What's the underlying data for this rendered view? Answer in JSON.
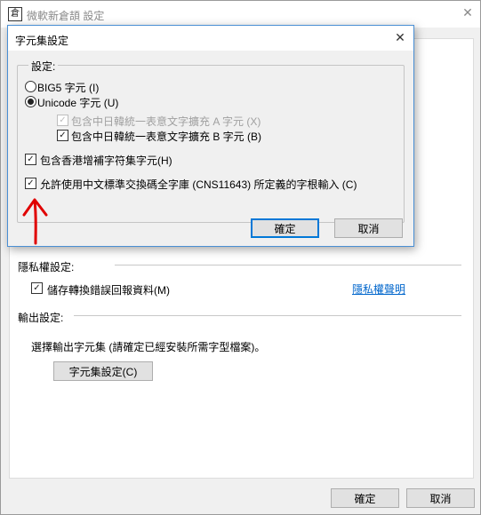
{
  "window": {
    "title": "微軟新倉頡 設定",
    "icon_name": "cangjie-app-icon",
    "icon_glyph": "倉",
    "close_glyph": "✕"
  },
  "privacy": {
    "section_label": "隱私權設定:",
    "checkbox_label": "儲存轉換錯誤回報資料(M)",
    "checkbox_checked": true,
    "link": "隱私權聲明"
  },
  "output": {
    "section_label": "輸出設定:",
    "description": "選擇輸出字元集 (請確定已經安裝所需字型檔案)。",
    "charset_button": "字元集設定(C)"
  },
  "footer": {
    "ok": "確定",
    "cancel": "取消"
  },
  "dialog": {
    "title": "字元集設定",
    "close_glyph": "✕",
    "group_label": "設定:",
    "radio_big5": "BIG5 字元 (I)",
    "radio_unicode": "Unicode 字元 (U)",
    "selected": "unicode",
    "ext_a": "包含中日韓統一表意文字擴充 A 字元 (X)",
    "ext_a_checked": true,
    "ext_a_disabled": true,
    "ext_b": "包含中日韓統一表意文字擴充 B 字元 (B)",
    "ext_b_checked": true,
    "hkscs": "包含香港增補字符集字元(H)",
    "hkscs_checked": true,
    "cns": "允許使用中文標準交換碼全字庫 (CNS11643) 所定義的字根輸入 (C)",
    "cns_checked": true,
    "ok": "確定",
    "cancel": "取消"
  },
  "annotation": {
    "arrow_color": "#e00000"
  }
}
